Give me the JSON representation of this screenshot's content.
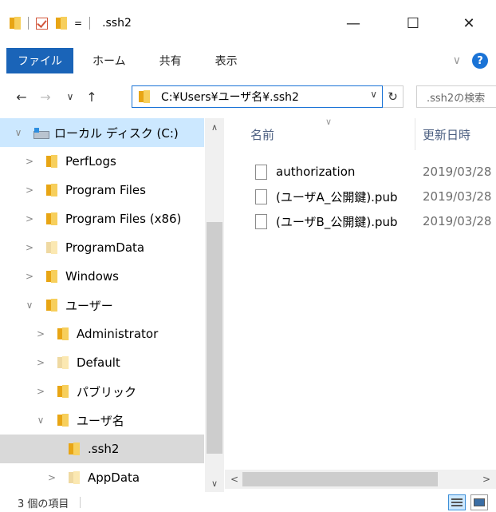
{
  "window": {
    "title": ".ssh2",
    "qat_dropdown": "=",
    "minimize": "—",
    "maximize": "☐",
    "close": "✕"
  },
  "ribbon": {
    "tabs": [
      "ファイル",
      "ホーム",
      "共有",
      "表示"
    ],
    "expand_glyph": "∨",
    "help_glyph": "?"
  },
  "addressbar": {
    "back": "←",
    "forward": "→",
    "recent": "∨",
    "up": "↑",
    "path": "C:¥Users¥ユーザ名¥.ssh2",
    "dropdown": "∨",
    "refresh": "↻",
    "search_placeholder": ".ssh2の検索"
  },
  "navpane": {
    "items": [
      {
        "label": "ローカル ディスク (C:)",
        "chev": "∨",
        "kind": "drive",
        "state": "selected"
      },
      {
        "label": "PerfLogs",
        "chev": ">",
        "kind": "folder"
      },
      {
        "label": "Program Files",
        "chev": ">",
        "kind": "folder"
      },
      {
        "label": "Program Files (x86)",
        "chev": ">",
        "kind": "folder"
      },
      {
        "label": "ProgramData",
        "chev": ">",
        "kind": "folder-pale"
      },
      {
        "label": "Windows",
        "chev": ">",
        "kind": "folder"
      },
      {
        "label": "ユーザー",
        "chev": "∨",
        "kind": "folder"
      },
      {
        "label": "Administrator",
        "chev": ">",
        "kind": "folder"
      },
      {
        "label": "Default",
        "chev": ">",
        "kind": "folder-pale"
      },
      {
        "label": "パブリック",
        "chev": ">",
        "kind": "folder"
      },
      {
        "label": "ユーザ名",
        "chev": "∨",
        "kind": "folder"
      },
      {
        "label": ".ssh2",
        "chev": "",
        "kind": "folder",
        "state": "current"
      },
      {
        "label": "AppData",
        "chev": ">",
        "kind": "folder-pale"
      }
    ],
    "scroll_up": "∧",
    "scroll_down": "∨"
  },
  "filelist": {
    "columns": {
      "name": "名前",
      "date": "更新日時"
    },
    "sort_glyph": "∨",
    "files": [
      {
        "name": "authorization",
        "date": "2019/03/28"
      },
      {
        "name": "(ユーザA_公開鍵).pub",
        "date": "2019/03/28"
      },
      {
        "name": "(ユーザB_公開鍵).pub",
        "date": "2019/03/28"
      }
    ],
    "scroll_left": "<",
    "scroll_right": ">"
  },
  "statusbar": {
    "item_count": "3 個の項目"
  },
  "colors": {
    "accent": "#1a64b8",
    "selected_bg": "#cce8ff",
    "current_bg": "#d9d9d9",
    "folder": "#f7cf5c"
  },
  "icons": {
    "folder": "folder-icon",
    "file": "file-icon",
    "drive": "drive-icon",
    "help": "help-icon",
    "refresh": "refresh-icon"
  }
}
